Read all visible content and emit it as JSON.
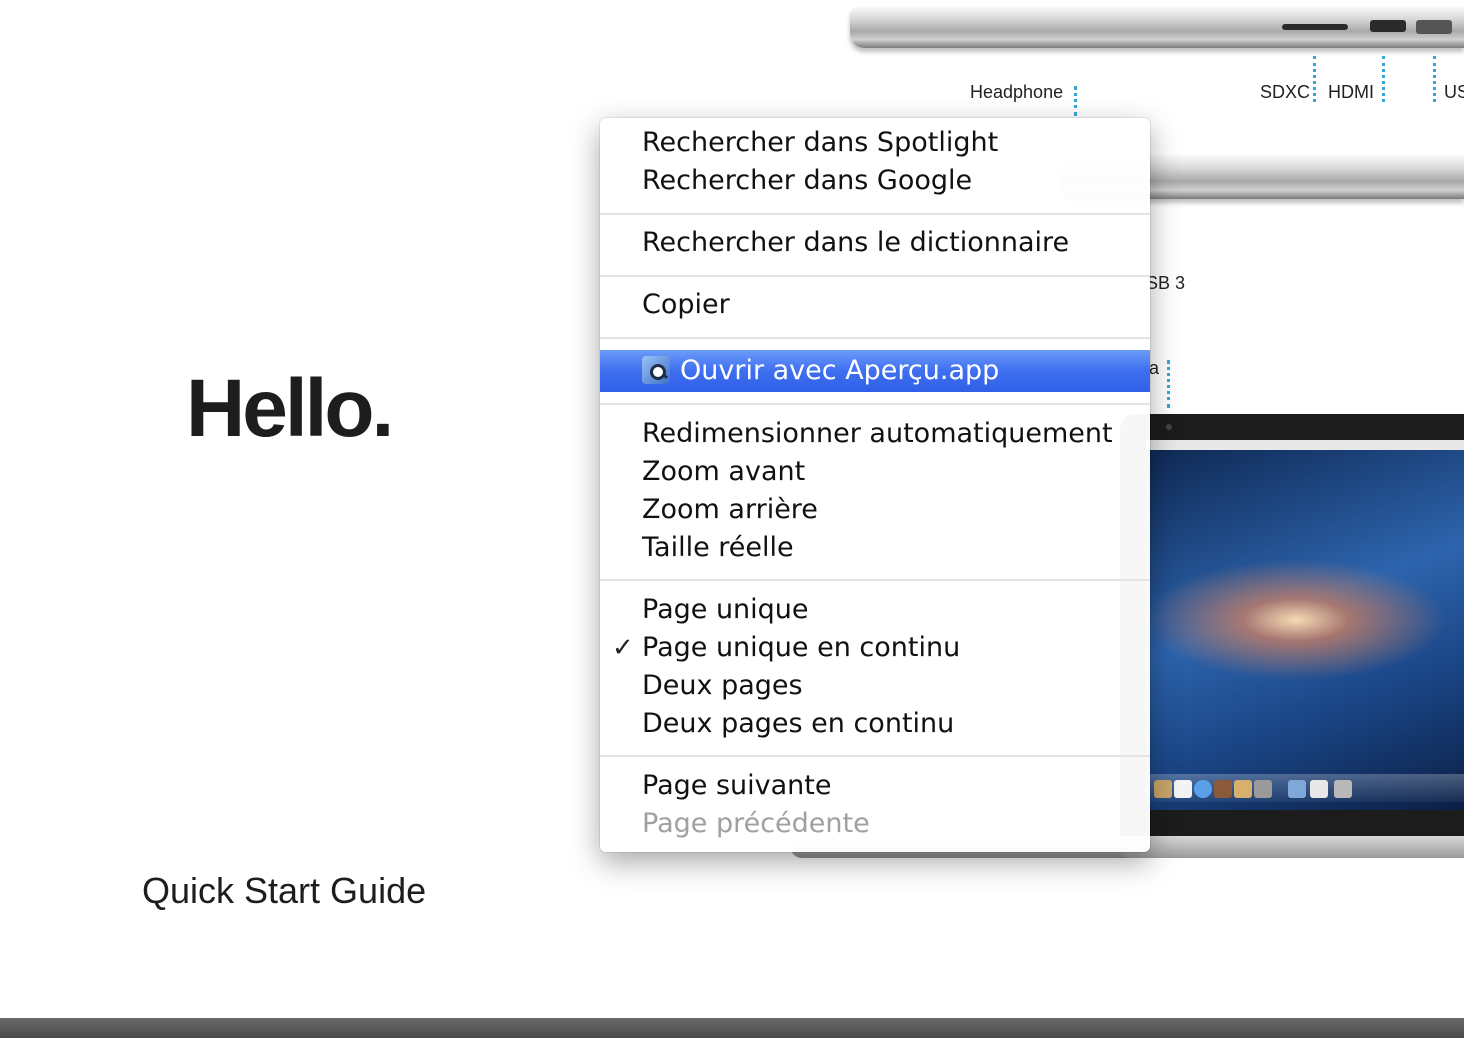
{
  "document": {
    "title": "Hello.",
    "subtitle": "Quick Start Guide",
    "port_labels": {
      "headphone": "Headphone",
      "sdxc": "SDXC",
      "hdmi": "HDMI",
      "usb_partial": "US",
      "usb3_partial": "SB 3",
      "partial_a": "a"
    }
  },
  "context_menu": {
    "groups": [
      {
        "items": [
          {
            "label": "Rechercher dans Spotlight",
            "enabled": true
          },
          {
            "label": "Rechercher dans Google",
            "enabled": true
          }
        ]
      },
      {
        "items": [
          {
            "label": "Rechercher dans le dictionnaire",
            "enabled": true
          }
        ]
      },
      {
        "items": [
          {
            "label": "Copier",
            "enabled": true
          }
        ]
      },
      {
        "items": [
          {
            "label": "Ouvrir avec Aperçu.app",
            "enabled": true,
            "highlighted": true,
            "icon": "preview-app-icon"
          }
        ]
      },
      {
        "items": [
          {
            "label": "Redimensionner automatiquement",
            "enabled": true
          },
          {
            "label": "Zoom avant",
            "enabled": true
          },
          {
            "label": "Zoom arrière",
            "enabled": true
          },
          {
            "label": "Taille réelle",
            "enabled": true
          }
        ]
      },
      {
        "items": [
          {
            "label": "Page unique",
            "enabled": true
          },
          {
            "label": "Page unique en continu",
            "enabled": true,
            "checked": true,
            "icon": "checkmark-icon"
          },
          {
            "label": "Deux pages",
            "enabled": true
          },
          {
            "label": "Deux pages en continu",
            "enabled": true
          }
        ]
      },
      {
        "items": [
          {
            "label": "Page suivante",
            "enabled": true
          },
          {
            "label": "Page précédente",
            "enabled": false
          }
        ]
      }
    ]
  },
  "colors": {
    "highlight": "#3f6ff0",
    "leader_lines": "#39a6d8",
    "disabled_text": "#a0a0a0"
  }
}
